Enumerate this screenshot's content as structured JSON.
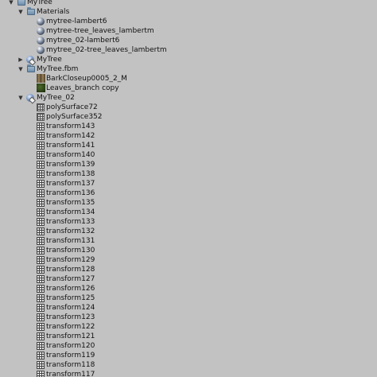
{
  "tree": {
    "root": {
      "label": "MyTree",
      "expanded": true,
      "icon": "prefab-icon"
    },
    "materials_folder": {
      "label": "Materials",
      "expanded": true,
      "icon": "folder-icon"
    },
    "materials": [
      {
        "label": "mytree-lambert6",
        "icon": "material-icon"
      },
      {
        "label": "mytree-tree_leaves_lambertm",
        "icon": "material-icon"
      },
      {
        "label": "mytree_02-lambert6",
        "icon": "material-icon"
      },
      {
        "label": "mytree_02-tree_leaves_lambertm",
        "icon": "material-icon"
      }
    ],
    "mytree_prefab": {
      "label": "MyTree",
      "expanded": false,
      "icon": "prefab-icon"
    },
    "fbm_folder": {
      "label": "MyTree.fbm",
      "expanded": true,
      "icon": "folder-icon"
    },
    "textures": [
      {
        "label": "BarkCloseup0005_2_M",
        "icon": "texture-icon"
      },
      {
        "label": "Leaves_branch copy",
        "icon": "texture-icon"
      }
    ],
    "mytree02_prefab": {
      "label": "MyTree_02",
      "expanded": true,
      "icon": "prefab-icon"
    },
    "meshes": [
      {
        "label": "polySurface72",
        "icon": "mesh-icon"
      },
      {
        "label": "polySurface352",
        "icon": "mesh-icon"
      }
    ],
    "transforms": [
      "transform143",
      "transform142",
      "transform141",
      "transform140",
      "transform139",
      "transform138",
      "transform137",
      "transform136",
      "transform135",
      "transform134",
      "transform133",
      "transform132",
      "transform131",
      "transform130",
      "transform129",
      "transform128",
      "transform127",
      "transform126",
      "transform125",
      "transform124",
      "transform123",
      "transform122",
      "transform121",
      "transform120",
      "transform119",
      "transform118",
      "transform117"
    ]
  }
}
